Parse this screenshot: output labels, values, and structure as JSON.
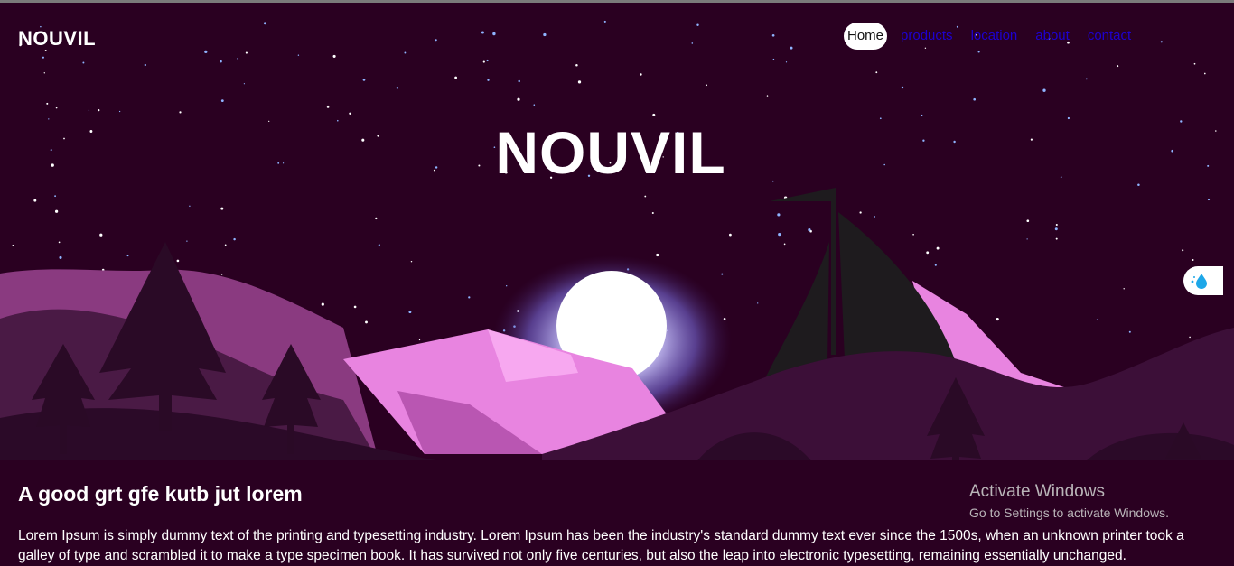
{
  "header": {
    "brand": "NOUVIL",
    "nav": [
      {
        "label": "Home"
      },
      {
        "label": "products"
      },
      {
        "label": "location"
      },
      {
        "label": "about"
      },
      {
        "label": "contact"
      }
    ]
  },
  "hero": {
    "title": "NOUVIL"
  },
  "main": {
    "heading": "A good grt gfe kutb jut lorem",
    "paragraph": "Lorem Ipsum is simply dummy text of the printing and typesetting industry. Lorem Ipsum has been the industry's standard dummy text ever since the 1500s, when an unknown printer took a galley of type and scrambled it to make a type specimen book. It has survived not only five centuries, but also the leap into electronic typesetting, remaining essentially unchanged."
  },
  "watermark": {
    "title": "Activate Windows",
    "subtitle": "Go to Settings to activate Windows."
  },
  "colors": {
    "background": "#2a0021",
    "nav_link": "#1e00d0",
    "mountain_pink": "#e87fe0",
    "hill_purple": "#3a0f35"
  },
  "icons": {
    "side_widget": "water-drop-icon"
  }
}
